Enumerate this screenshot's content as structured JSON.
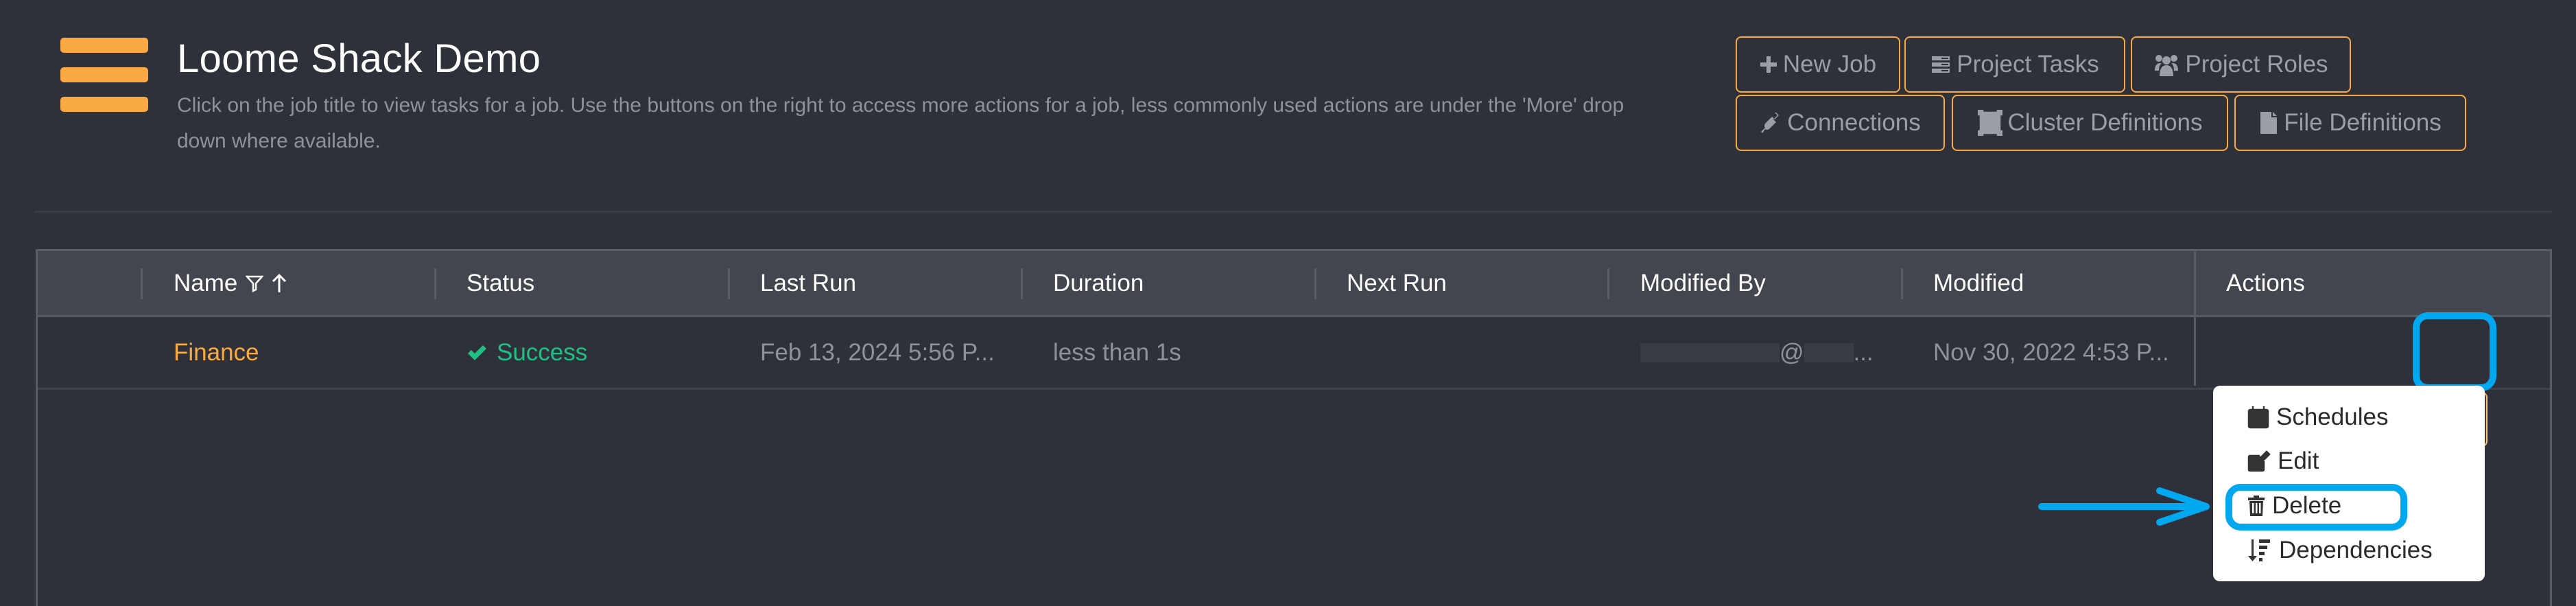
{
  "header": {
    "title": "Loome Shack Demo",
    "description": "Click on the job title to view tasks for a job. Use the buttons on the right to access more actions for a job, less commonly used actions are under the 'More' drop down where available."
  },
  "toolbar": {
    "new_job": "New Job",
    "project_tasks": "Project Tasks",
    "project_roles": "Project Roles",
    "connections": "Connections",
    "cluster_definitions": "Cluster Definitions",
    "file_definitions": "File Definitions"
  },
  "table": {
    "columns": [
      "Name",
      "Status",
      "Last Run",
      "Duration",
      "Next Run",
      "Modified By",
      "Modified",
      "Actions"
    ],
    "rows": [
      {
        "name": "Finance",
        "status": "Success",
        "last_run": "Feb 13, 2024 5:56 P...",
        "duration": "less than 1s",
        "next_run": "",
        "modified_by_at": "@",
        "modified_by_ellipsis": "...",
        "modified": "Nov 30, 2022 4:53 P..."
      }
    ]
  },
  "row_actions": {
    "run": "play-icon",
    "history": "history-icon",
    "toggle": "toggle-icon",
    "more": "more-icon"
  },
  "more_menu": {
    "items": [
      {
        "label": "Schedules",
        "icon": "calendar-icon"
      },
      {
        "label": "Edit",
        "icon": "edit-icon"
      },
      {
        "label": "Delete",
        "icon": "trash-icon"
      },
      {
        "label": "Dependencies",
        "icon": "sort-dependencies-icon"
      }
    ]
  },
  "colors": {
    "background": "#2f313a",
    "accent": "#f9ab41",
    "success": "#20c084",
    "annotation": "#00a8ef"
  }
}
